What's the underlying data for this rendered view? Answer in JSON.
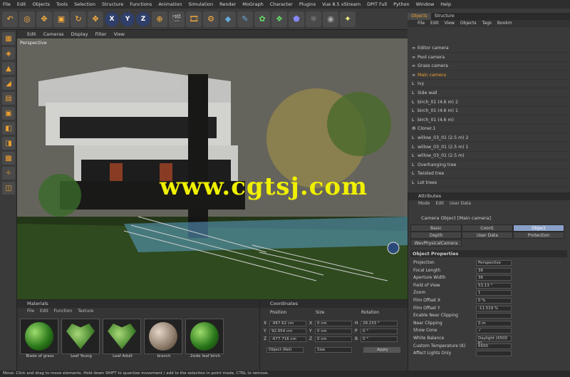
{
  "menubar": [
    "File",
    "Edit",
    "Objects",
    "Tools",
    "Selection",
    "Structure",
    "Functions",
    "Animation",
    "Simulation",
    "Render",
    "MoGraph",
    "Character",
    "Plugins",
    "Vue 8.5 xStream",
    "DPIT Full",
    "Python",
    "Window",
    "Help"
  ],
  "axis": [
    "X",
    "Y",
    "Z"
  ],
  "viewport": {
    "menu": [
      "Edit",
      "Cameras",
      "Display",
      "Filter",
      "View"
    ],
    "label": "Perspective"
  },
  "watermark": "www.cgtsj.com",
  "objects": {
    "tabs": [
      "Objects",
      "Structure"
    ],
    "menu": [
      "File",
      "Edit",
      "View",
      "Objects",
      "Tags",
      "Bookm"
    ],
    "items": [
      "Editor camera",
      "Pool camera",
      "Grass camera",
      "Main camera",
      "Ivy",
      "Side wall",
      "birch_01 (4.6 m) 2",
      "birch_01 (4.6 m) 1",
      "birch_01 (4.6 m)",
      "Cloner.1",
      "willow_03_01 (2.5 m) 2",
      "willow_03_01 (2.5 m) 1",
      "willow_03_01 (2.5 m)",
      "Overhanging tree",
      "Twisted tree",
      "Lot trees"
    ],
    "selected_color": "#f0a030"
  },
  "attributes": {
    "title": "Attributes",
    "menu": [
      "Mode",
      "Edit",
      "User Data"
    ],
    "object_name": "Camera Object [Main camera]",
    "tabs_row1": [
      "Basic",
      "Coord.",
      "Object"
    ],
    "tabs_row2": [
      "Depth",
      "User Data",
      "Protection"
    ],
    "tab3": "WavPhysicalCamera",
    "section": "Object Properties",
    "props": [
      {
        "label": "Projection",
        "value": "Perspective"
      },
      {
        "label": "Focal Length",
        "value": "36"
      },
      {
        "label": "Aperture Width",
        "value": "36"
      },
      {
        "label": "Field of View",
        "value": "53.13 °"
      },
      {
        "label": "Zoom",
        "value": "1"
      },
      {
        "label": "Film Offset X",
        "value": "0 %"
      },
      {
        "label": "Film Offset Y",
        "value": "-11.519 %"
      },
      {
        "label": "Enable Near Clipping",
        "value": ""
      },
      {
        "label": "Near Clipping",
        "value": "0 m"
      },
      {
        "label": "Show Cone",
        "value": "✓"
      },
      {
        "label": "White Balance",
        "value": "Daylight (6500 K)"
      },
      {
        "label": "Custom Temperature (K)",
        "value": "6500"
      },
      {
        "label": "Affect Lights Only",
        "value": ""
      }
    ]
  },
  "materials": {
    "title": "Materials",
    "menu": [
      "File",
      "Edit",
      "Function",
      "Texture"
    ],
    "items": [
      "Blade of grass",
      "Leaf Young",
      "Leaf Adult",
      "branch",
      "2side leaf birch"
    ]
  },
  "coordinates": {
    "title": "Coordinates",
    "headers": [
      "Position",
      "Size",
      "Rotation"
    ],
    "rows": [
      {
        "a": "X",
        "pos": "-967.62 cm",
        "s": "X",
        "size": "0 cm",
        "r": "H",
        "rot": "28.233 °"
      },
      {
        "a": "Y",
        "pos": "92.054 cm",
        "s": "Y",
        "size": "0 cm",
        "r": "P",
        "rot": "0 °"
      },
      {
        "a": "Z",
        "pos": "-677.716 cm",
        "s": "Z",
        "size": "0 cm",
        "r": "B",
        "rot": "0 °"
      }
    ],
    "mode": "Object (Rel)",
    "sizemode": "Size",
    "apply": "Apply"
  },
  "status": "Move: Click and drag to move elements. Hold down SHIFT to quantize movement / add to the selection in point mode, CTRL to remove."
}
